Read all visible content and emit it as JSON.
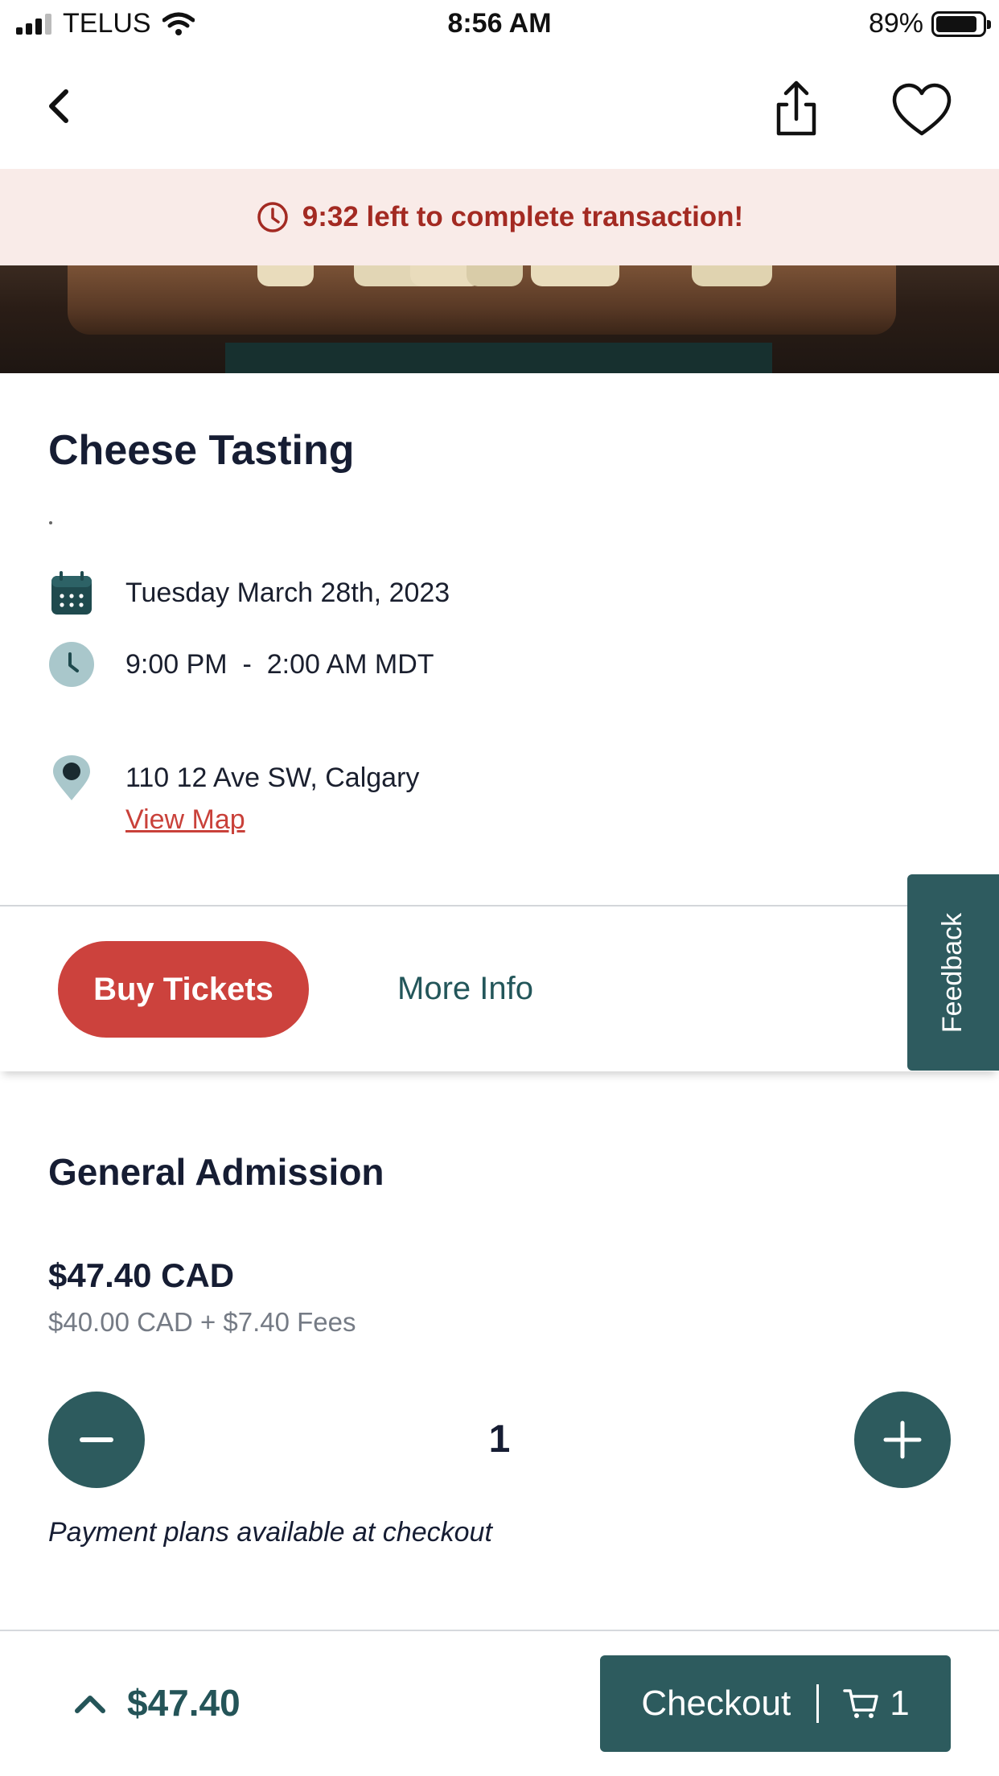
{
  "status_bar": {
    "carrier": "TELUS",
    "time": "8:56 AM",
    "battery": "89%"
  },
  "icons": {
    "back": "chevron-left-icon",
    "share": "share-icon",
    "favorite": "heart-icon",
    "timer": "clock-icon",
    "date": "calendar-icon",
    "time": "clock-icon",
    "location": "map-pin-icon",
    "minus": "minus-icon",
    "plus": "plus-icon",
    "expand": "chevron-up-icon",
    "cart": "cart-icon"
  },
  "timer_banner": {
    "text": "9:32 left to complete transaction!"
  },
  "event": {
    "title": "Cheese Tasting",
    "date": "Tuesday March 28th, 2023",
    "time": "9:00 PM  -  2:00 AM MDT",
    "address": "110 12 Ave SW, Calgary",
    "view_map": "View Map"
  },
  "tabs": {
    "buy": "Buy Tickets",
    "more": "More Info"
  },
  "feedback_label": "Feedback",
  "ticket": {
    "name": "General Admission",
    "price": "$47.40 CAD",
    "breakdown": "$40.00 CAD + $7.40 Fees",
    "quantity": "1",
    "payment_note": "Payment plans available at checkout"
  },
  "footer": {
    "total": "$47.40",
    "checkout_label": "Checkout",
    "cart_count": "1"
  },
  "colors": {
    "accent_red": "#cc423d",
    "teal": "#2d5b5e",
    "banner_bg": "#f9ebe8",
    "banner_text": "#a32a22"
  }
}
